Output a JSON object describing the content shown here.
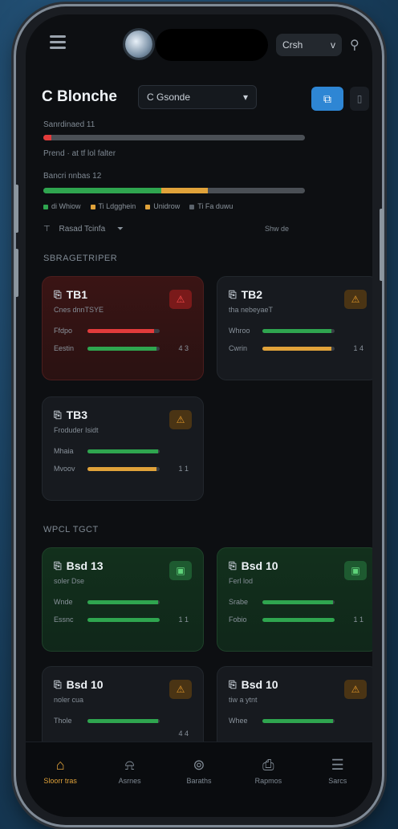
{
  "topbar": {
    "user_label": "Crsh",
    "chevron": "v"
  },
  "header": {
    "title": "C Blonche",
    "select_value": "C Gsonde",
    "primary_btn": "⧉",
    "secondary_btn": "▯"
  },
  "summary": {
    "row1_label": "Sanrdinaed  11",
    "row1_percent": 3,
    "row2_label": "Prend · at tf lol falter",
    "row3_label": "Bancri nnbas  12",
    "row3_green": 45,
    "row3_amber": 18,
    "legend": [
      {
        "label": "di Whiow",
        "color": "#2fa54f"
      },
      {
        "label": "Ti Ldgghein",
        "color": "#e0a23a"
      },
      {
        "label": "Unidrow",
        "color": "#e0a23a"
      },
      {
        "label": "Ti Fa duwu",
        "color": "#5b636c"
      }
    ],
    "filter_label": "Rasad Tcinfa",
    "view_all": "Shw de"
  },
  "sections": {
    "top": "SBRAGETRIPER",
    "bottom": "WPCL TGCT"
  },
  "cards": [
    {
      "name": "TB1",
      "sub": "Cnes dnnTSYE",
      "icon": "⚠",
      "tone": "red",
      "badge": "⚠",
      "rows": [
        {
          "label": "Ffdpo",
          "value": 92,
          "color": "#e23b3b"
        },
        {
          "label": "Eestin",
          "value": 95,
          "color": "#2fa54f"
        }
      ],
      "count": "4 3"
    },
    {
      "name": "TB2",
      "sub": "tha nebeyaeT",
      "icon": "⚠",
      "tone": "dark",
      "badge": "⚠",
      "rows": [
        {
          "label": "Whroo",
          "value": 95,
          "color": "#2fa54f"
        },
        {
          "label": "Cwrin",
          "value": 95,
          "color": "#e0a23a"
        }
      ],
      "count": "1 4"
    },
    {
      "name": "TB3",
      "sub": "Froduder Isidt",
      "icon": "⚠",
      "tone": "dark",
      "badge": "⚠",
      "rows": [
        {
          "label": "Mhaia",
          "value": 98,
          "color": "#2fa54f"
        },
        {
          "label": "Mvoov",
          "value": 96,
          "color": "#e0a23a"
        }
      ],
      "count": "1 1"
    },
    {
      "name": "Bsd 13",
      "sub": "soler Dse",
      "icon": "▣",
      "tone": "green",
      "badge": "▣",
      "rows": [
        {
          "label": "Wnde",
          "value": 98,
          "color": "#2fa54f"
        },
        {
          "label": "Essnc",
          "value": 100,
          "color": "#2fa54f"
        }
      ],
      "count": "1 1"
    },
    {
      "name": "Bsd 10",
      "sub": "Ferl lod",
      "icon": "▣",
      "tone": "green",
      "badge": "▣",
      "rows": [
        {
          "label": "Srabe",
          "value": 98,
          "color": "#2fa54f"
        },
        {
          "label": "Fobio",
          "value": 100,
          "color": "#2fa54f"
        }
      ],
      "count": "1 1"
    },
    {
      "name": "Bsd 10",
      "sub": "noler cua",
      "icon": "▣",
      "tone": "dark",
      "badge": "⚠",
      "rows": [
        {
          "label": "Thole",
          "value": 98,
          "color": "#2fa54f"
        }
      ],
      "count": "4 4"
    },
    {
      "name": "Bsd 10",
      "sub": "tiw a ytnt",
      "icon": "▣",
      "tone": "dark",
      "badge": "⚠",
      "rows": [
        {
          "label": "Whee",
          "value": 98,
          "color": "#2fa54f"
        }
      ],
      "count": ""
    }
  ],
  "nav": [
    {
      "label": "Sloorr tras",
      "icon": "⌂",
      "active": true
    },
    {
      "label": "Asrnes",
      "icon": "⍾",
      "active": false
    },
    {
      "label": "Baraths",
      "icon": "⊚",
      "active": false
    },
    {
      "label": "Rapmos",
      "icon": "⎙",
      "active": false
    },
    {
      "label": "Sarcs",
      "icon": "☰",
      "active": false
    }
  ]
}
